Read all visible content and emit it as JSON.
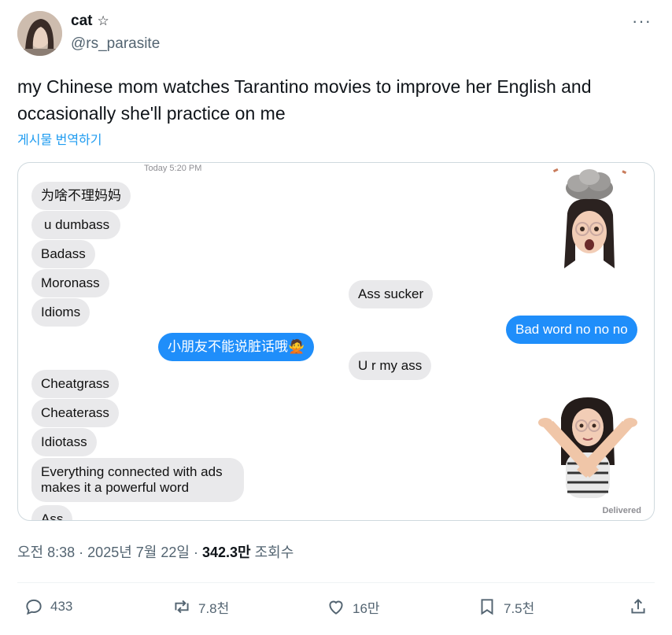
{
  "author": {
    "display_name": "cat",
    "badge": "☆",
    "handle": "@rs_parasite"
  },
  "more_label": "···",
  "tweet": {
    "text": "my Chinese mom watches Tarantino movies to improve her English and occasionally she'll practice on me",
    "translate_label": "게시물 번역하기"
  },
  "media": {
    "timestamp": "Today 5:20 PM",
    "messages": [
      {
        "text": "为啥不理妈妈"
      },
      {
        "text": "u dumbass"
      },
      {
        "text": "Badass"
      },
      {
        "text": "Moronass"
      },
      {
        "text": "Idioms"
      },
      {
        "text": "Ass sucker"
      },
      {
        "text": "Bad word no no no"
      },
      {
        "text": "小朋友不能说脏话哦🙅"
      },
      {
        "text": "U r my ass"
      },
      {
        "text": "Cheatgrass"
      },
      {
        "text": "Cheaterass"
      },
      {
        "text": "Idiotass"
      },
      {
        "text": "Everything connected with ads makes it a powerful word"
      },
      {
        "text": "Ass"
      }
    ],
    "delivered": "Delivered"
  },
  "meta": {
    "time": "오전 8:38",
    "date": "2025년 7월 22일",
    "views_count": "342.3만",
    "views_label": "조회수"
  },
  "actions": {
    "replies": "433",
    "reposts": "7.8천",
    "likes": "16만",
    "bookmarks": "7.5천"
  },
  "colors": {
    "link": "#1d9bf0",
    "imessage_blue": "#1f8efa",
    "bubble_gray": "#e9e9eb",
    "secondary_text": "#536471"
  }
}
